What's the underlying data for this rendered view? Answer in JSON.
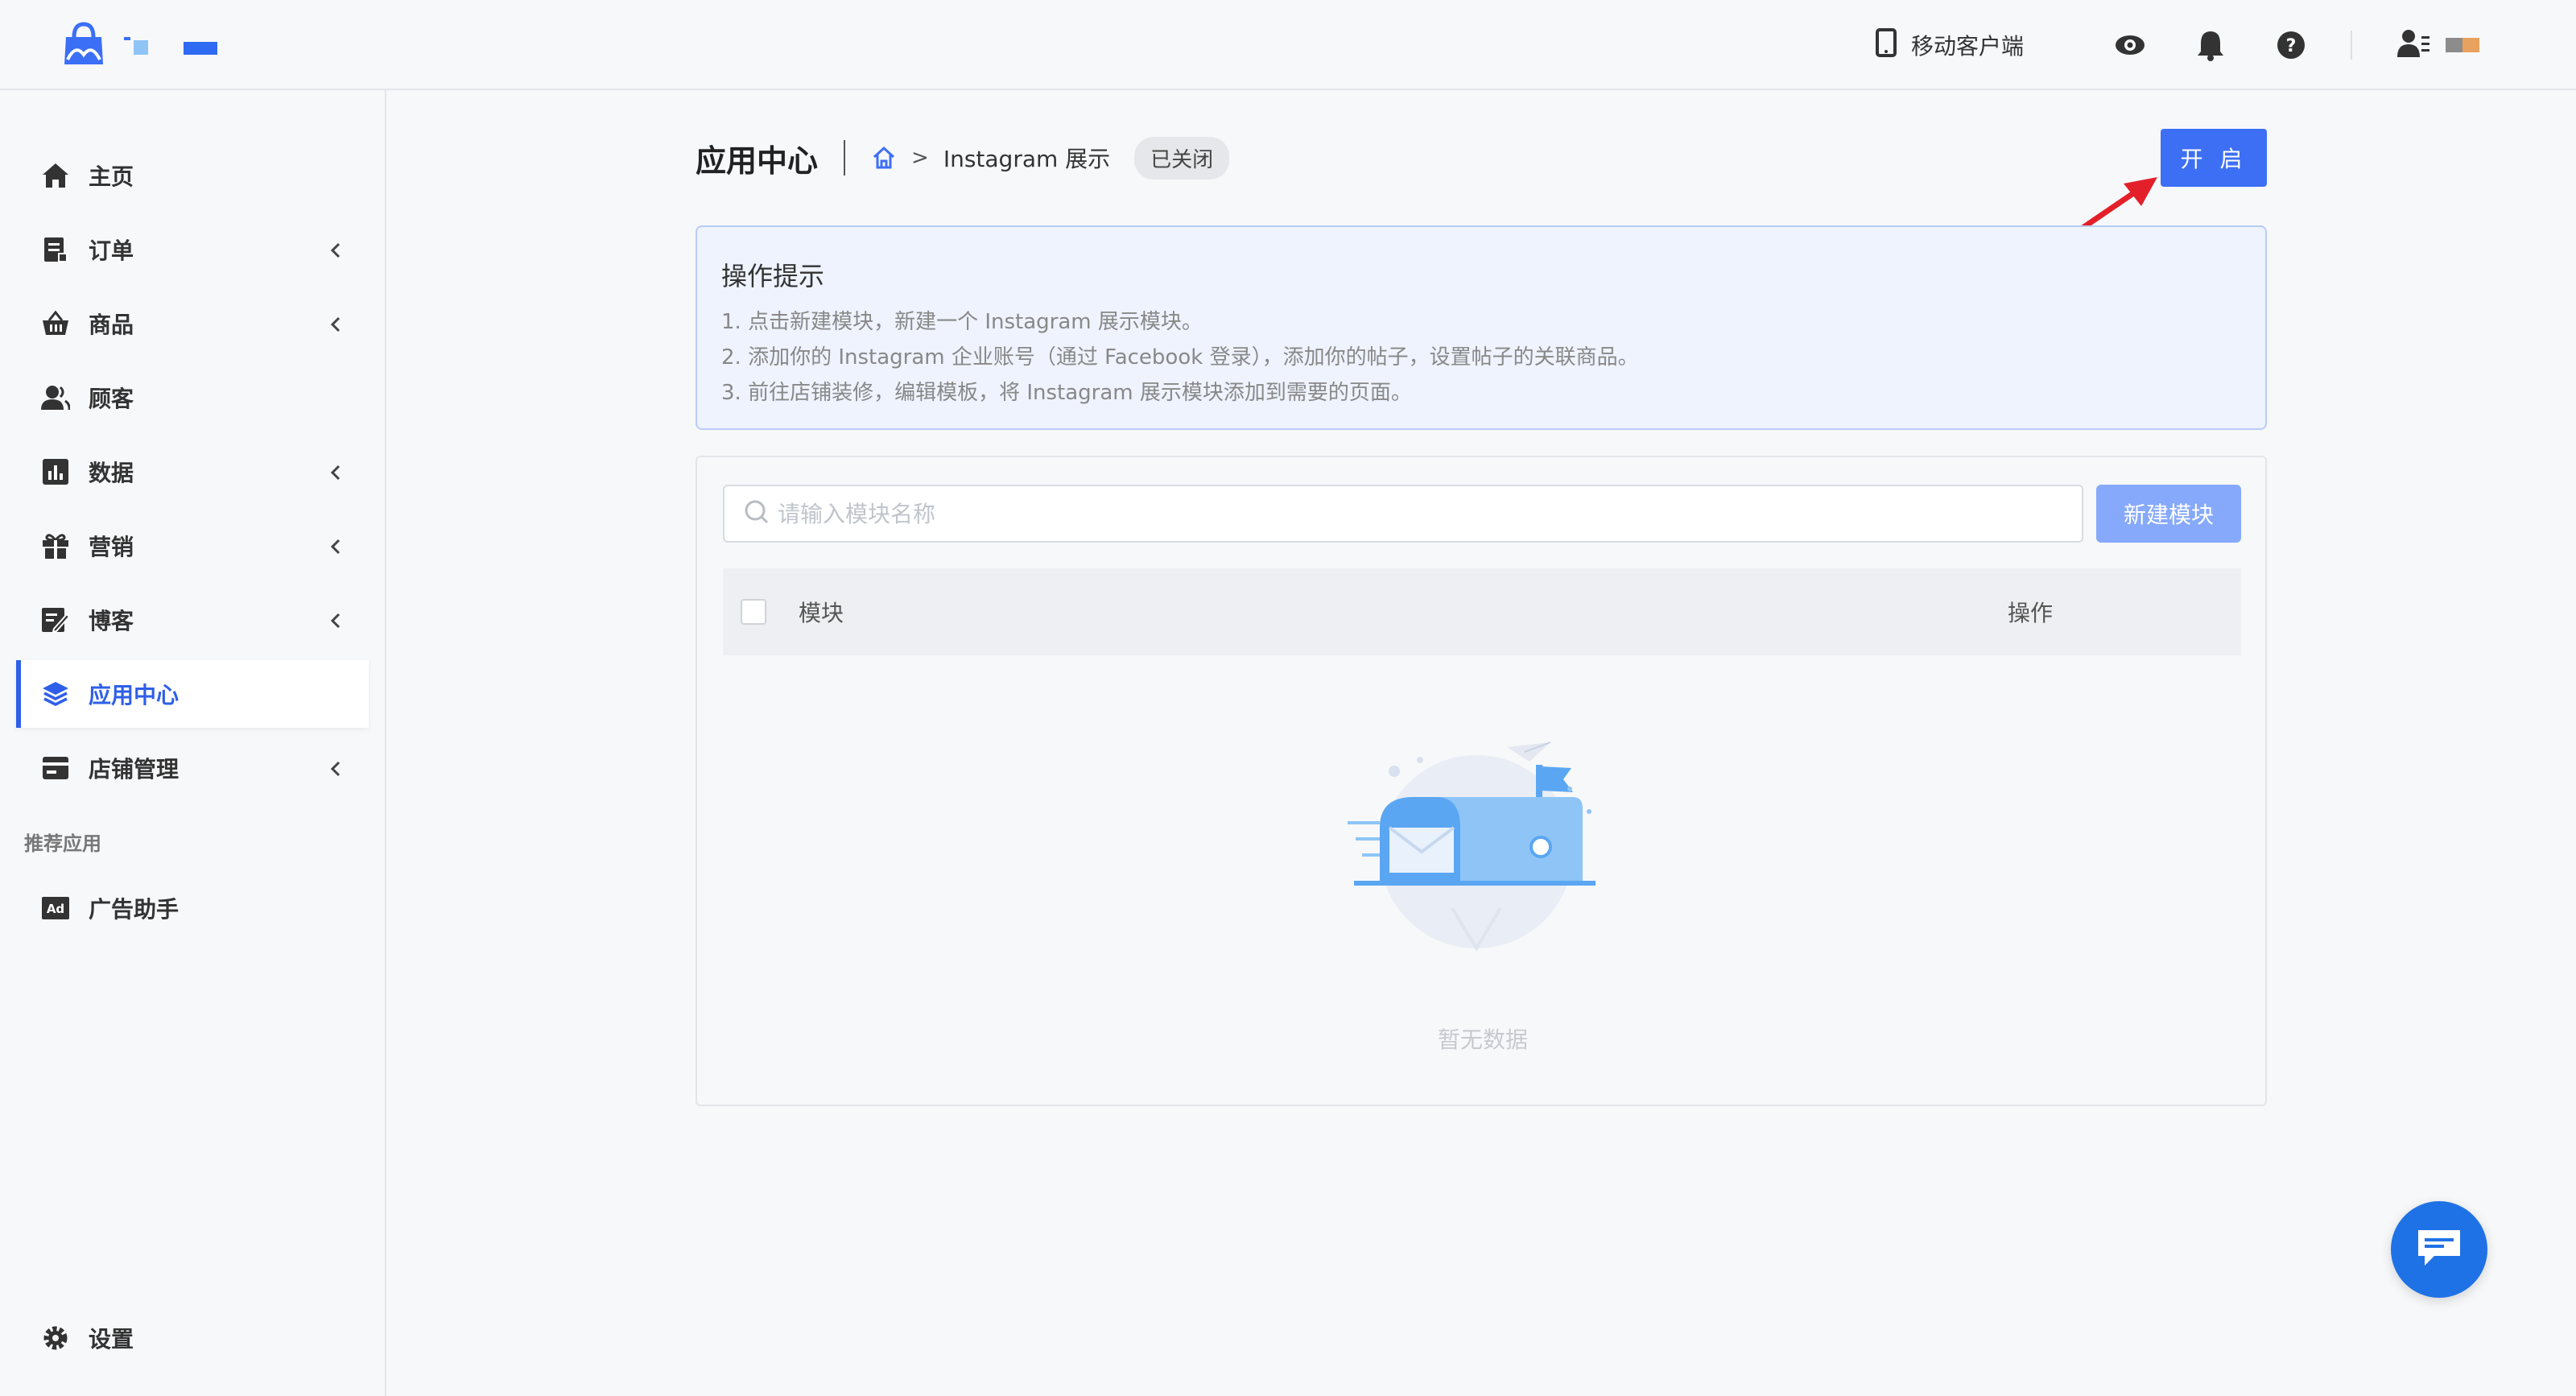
{
  "header": {
    "mobile_client_label": "移动客户端",
    "icons": [
      "phone-icon",
      "eye-icon",
      "bell-icon",
      "help-icon",
      "user-menu-icon"
    ]
  },
  "sidebar": {
    "items": [
      {
        "label": "主页",
        "icon": "home-icon",
        "has_submenu": false
      },
      {
        "label": "订单",
        "icon": "order-icon",
        "has_submenu": true
      },
      {
        "label": "商品",
        "icon": "basket-icon",
        "has_submenu": true
      },
      {
        "label": "顾客",
        "icon": "customers-icon",
        "has_submenu": false
      },
      {
        "label": "数据",
        "icon": "chart-icon",
        "has_submenu": true
      },
      {
        "label": "营销",
        "icon": "gift-icon",
        "has_submenu": true
      },
      {
        "label": "博客",
        "icon": "blog-edit-icon",
        "has_submenu": true
      },
      {
        "label": "应用中心",
        "icon": "layers-icon",
        "has_submenu": false,
        "active": true
      },
      {
        "label": "店铺管理",
        "icon": "store-icon",
        "has_submenu": true
      }
    ],
    "section_label": "推荐应用",
    "recommended": [
      {
        "label": "广告助手",
        "icon": "ad-icon"
      }
    ],
    "settings_label": "设置"
  },
  "main": {
    "title": "应用中心",
    "breadcrumb_separator": ">",
    "breadcrumb_current": "Instagram 展示",
    "status": "已关闭",
    "open_button": "开 启",
    "tips": {
      "title": "操作提示",
      "lines": [
        "1. 点击新建模块，新建一个 Instagram 展示模块。",
        "2. 添加你的 Instagram 企业账号（通过 Facebook 登录），添加你的帖子，设置帖子的关联商品。",
        "3. 前往店铺装修，编辑模板，将 Instagram 展示模块添加到需要的页面。"
      ]
    },
    "search_placeholder": "请输入模块名称",
    "new_module_button": "新建模块",
    "table": {
      "columns": [
        "模块",
        "操作"
      ]
    },
    "empty_text": "暂无数据"
  },
  "colors": {
    "accent": "#3d6ff5",
    "active_nav": "#2f5fe8",
    "annotation_arrow": "#e3202a",
    "chat_bubble": "#1f72e6"
  }
}
